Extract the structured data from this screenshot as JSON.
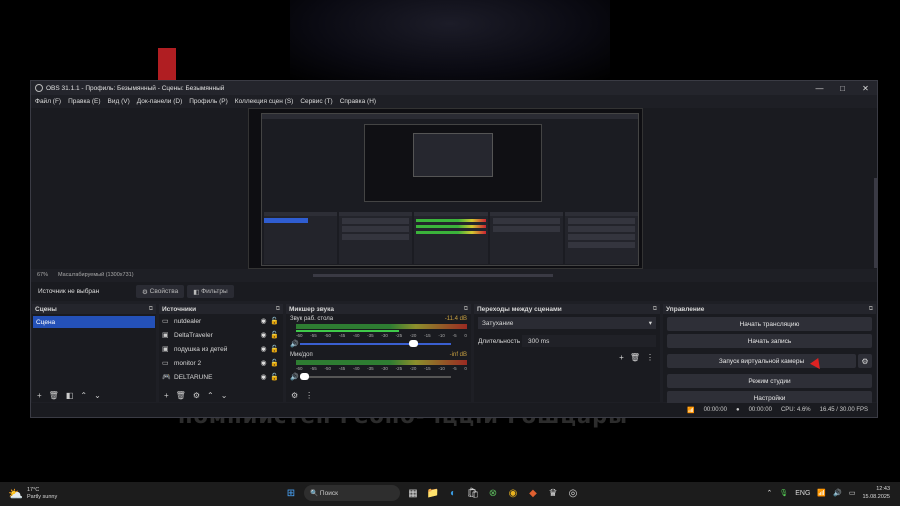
{
  "window": {
    "title": "OBS 31.1.1 - Профиль: Безымянный - Сцены: Безымянный",
    "controls": {
      "minimize": "—",
      "maximize": "□",
      "close": "✕"
    }
  },
  "menu": [
    "Файл (F)",
    "Правка (E)",
    "Вид (V)",
    "Док-панели (D)",
    "Профиль (P)",
    "Коллекция сцен (S)",
    "Сервис (T)",
    "Справка (H)"
  ],
  "zoom": {
    "percent": "67%",
    "mode": "Масштабируемый (1300x731)"
  },
  "source_bar": {
    "no_source": "Источник не выбран",
    "properties": "Свойства",
    "filters": "Фильтры"
  },
  "scenes": {
    "title": "Сцены",
    "items": [
      "Сцена"
    ]
  },
  "sources": {
    "title": "Источники",
    "items": [
      {
        "name": "nutdealer",
        "icon": "monitor-icon"
      },
      {
        "name": "DeltaTraveler",
        "icon": "window-icon"
      },
      {
        "name": "подушка из детей",
        "icon": "window-icon"
      },
      {
        "name": "monitor 2",
        "icon": "monitor-icon"
      },
      {
        "name": "DELTARUNE",
        "icon": "gamepad-icon"
      }
    ]
  },
  "mixer": {
    "title": "Микшер звука",
    "channels": [
      {
        "name": "Звук раб. стола",
        "db": "-11.4 dB",
        "volume": 0.75
      },
      {
        "name": "Мик/доп",
        "db": "-inf dB",
        "volume": 0.0
      }
    ],
    "ticks": [
      "-60",
      "-55",
      "-50",
      "-45",
      "-40",
      "-35",
      "-30",
      "-25",
      "-20",
      "-15",
      "-10",
      "-5",
      "0"
    ]
  },
  "transitions": {
    "title": "Переходы между сценами",
    "selected": "Затухание",
    "duration_label": "Длительность",
    "duration": "300 ms"
  },
  "controls": {
    "title": "Управление",
    "start_stream": "Начать трансляцию",
    "start_record": "Начать запись",
    "virtual_cam": "Запуск виртуальной камеры",
    "studio_mode": "Режим студии",
    "settings": "Настройки"
  },
  "status": {
    "stream_time": "00:00:00",
    "record_time": "00:00:00",
    "cpu": "CPU: 4.6%",
    "fps": "16.45 / 30.00 FPS"
  },
  "background_caption": "помпиистен Геоно- іццій Гошцары",
  "taskbar": {
    "temperature": "17°C",
    "condition": "Partly sunny",
    "search": "Поиск",
    "lang": "ENG",
    "time": "12:43",
    "date": "15.08.2025"
  },
  "colors": {
    "accent": "#2451b8",
    "window_bg": "#1e1f25",
    "dock_bg": "#1a1b20"
  }
}
